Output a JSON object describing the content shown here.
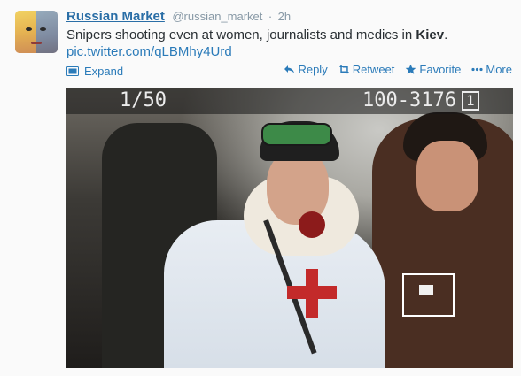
{
  "tweet": {
    "author_name": "Russian Market",
    "author_handle": "@russian_market",
    "separator": "·",
    "time": "2h",
    "text_before": "Snipers shooting even at women, journalists and medics in ",
    "text_bold": "Kiev",
    "text_after": ".",
    "link": "pic.twitter.com/qLBMhy4Urd"
  },
  "actions": {
    "expand": "Expand",
    "reply": "Reply",
    "retweet": "Retweet",
    "favorite": "Favorite",
    "more": "More"
  },
  "photo": {
    "lcd_left": "1/50",
    "lcd_right": "100-3176",
    "lcd_box": "1"
  },
  "colors": {
    "link": "#2b7bb9",
    "name": "#2a6ea6",
    "meta": "#8899a6",
    "text": "#292f33"
  },
  "icons": {
    "expand": "media-photo-icon",
    "reply": "reply-arrow-icon",
    "retweet": "retweet-arrows-icon",
    "favorite": "star-icon",
    "more": "more-dots-icon"
  }
}
